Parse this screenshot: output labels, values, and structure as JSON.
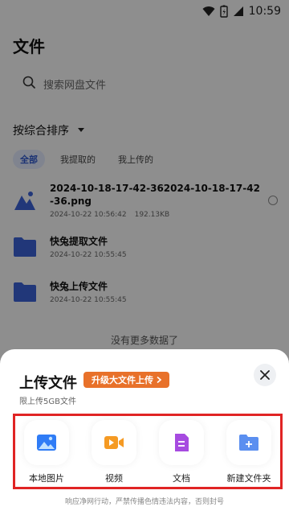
{
  "status_bar": {
    "time": "10:59"
  },
  "header": {
    "title": "文件"
  },
  "search": {
    "placeholder": "搜索网盘文件"
  },
  "sort": {
    "label": "按综合排序"
  },
  "filters": [
    {
      "label": "全部",
      "active": true
    },
    {
      "label": "我提取的",
      "active": false
    },
    {
      "label": "我上传的",
      "active": false
    }
  ],
  "files": [
    {
      "name": "2024-10-18-17-42-362024-10-18-17-42-36.png",
      "date": "2024-10-22 10:56:42",
      "size": "192.13KB",
      "type": "image"
    },
    {
      "name": "快兔提取文件",
      "date": "2024-10-22 10:55:45",
      "type": "folder"
    },
    {
      "name": "快兔上传文件",
      "date": "2024-10-22 10:55:45",
      "type": "folder"
    }
  ],
  "empty_note": "没有更多数据了",
  "sheet": {
    "title": "上传文件",
    "upgrade_label": "升级大文件上传",
    "limit_text": "限上传5GB文件",
    "options": [
      {
        "label": "本地图片",
        "icon": "image-icon",
        "color": "#2f7cf6"
      },
      {
        "label": "视频",
        "icon": "video-icon",
        "color": "#f59a23"
      },
      {
        "label": "文档",
        "icon": "document-icon",
        "color": "#a64be0"
      },
      {
        "label": "新建文件夹",
        "icon": "new-folder-icon",
        "color": "#5b8ff0"
      }
    ],
    "footer_note": "响应净网行动，严禁传播色情违法内容，否则封号"
  },
  "colors": {
    "accent": "#2f57c8",
    "upgrade": "#e8712a",
    "highlight": "#e02424"
  }
}
